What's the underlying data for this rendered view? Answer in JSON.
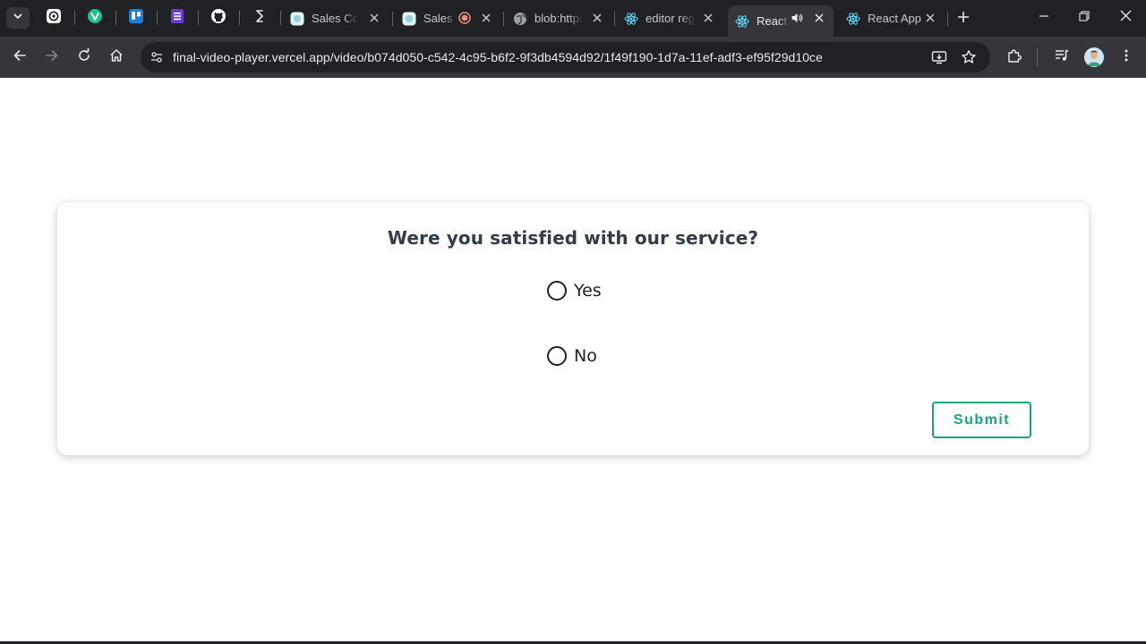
{
  "browser": {
    "tabs": [
      {
        "title": "Sales Coac",
        "favicon": "sales-app-icon"
      },
      {
        "title": "Sales",
        "favicon": "sales-app-icon",
        "indicator": "recording-icon"
      },
      {
        "title": "blob:https:",
        "favicon": "globe-icon"
      },
      {
        "title": "editor reg",
        "favicon": "react-icon"
      },
      {
        "title": "React",
        "favicon": "react-icon",
        "indicator": "speaker-icon",
        "active": true
      },
      {
        "title": "React App",
        "favicon": "react-icon"
      }
    ],
    "pinned_tabs": [
      "openai-icon",
      "vuetify-icon",
      "trello-icon",
      "forms-icon",
      "github-icon",
      "bolt-icon"
    ],
    "url": "final-video-player.vercel.app/video/b074d050-c542-4c95-b6f2-9f3db4594d92/1f49f190-1d7a-11ef-adf3-ef95f29d10ce"
  },
  "survey": {
    "question": "Were you satisfied with our service?",
    "options": [
      "Yes",
      "No"
    ],
    "submit_label": "Submit"
  },
  "colors": {
    "accent": "#1aa37f",
    "browser_dark": "#202124",
    "toolbar": "#35363a"
  }
}
